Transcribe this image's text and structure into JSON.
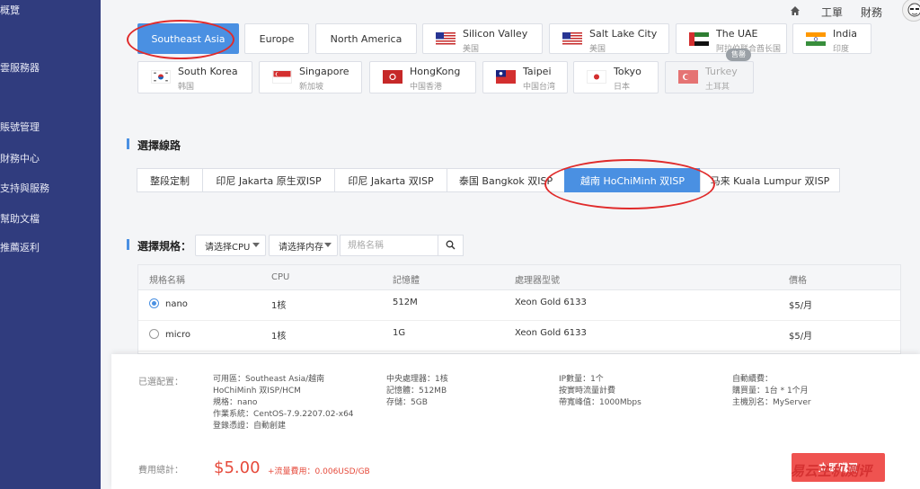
{
  "sidebar": {
    "items": [
      "概覽",
      "雲服務器",
      "賬號管理",
      "財務中心",
      "支持與服務",
      "幫助文檔",
      "推薦返利"
    ]
  },
  "topnav": {
    "workorder": "工單",
    "finance": "財務"
  },
  "regions": {
    "row1": [
      {
        "en": "Southeast Asia"
      },
      {
        "en": "Europe"
      },
      {
        "en": "North America"
      },
      {
        "en": "Silicon Valley",
        "zh": "美国",
        "flag": "us"
      },
      {
        "en": "Salt Lake City",
        "zh": "美国",
        "flag": "us"
      },
      {
        "en": "The UAE",
        "zh": "阿拉伯联合酋长国",
        "flag": "ae"
      },
      {
        "en": "India",
        "zh": "印度",
        "flag": "in"
      }
    ],
    "row2": [
      {
        "en": "South Korea",
        "zh": "韩国",
        "flag": "kr"
      },
      {
        "en": "Singapore",
        "zh": "新加坡",
        "flag": "sg"
      },
      {
        "en": "HongKong",
        "zh": "中国香港",
        "flag": "hk"
      },
      {
        "en": "Taipei",
        "zh": "中国台湾",
        "flag": "tw"
      },
      {
        "en": "Tokyo",
        "zh": "日本",
        "flag": "jp"
      },
      {
        "en": "Turkey",
        "zh": "土耳其",
        "flag": "tr"
      }
    ],
    "hot_badge": "售罄"
  },
  "line_section": {
    "title": "選擇線路",
    "tabs": [
      "整段定制",
      "印尼 Jakarta 原生双ISP",
      "印尼 Jakarta 双ISP",
      "泰国 Bangkok 双ISP",
      "越南 HoChiMinh 双ISP",
      "马来 Kuala Lumpur 双ISP"
    ]
  },
  "spec_section": {
    "title": "選擇規格：",
    "cpu_select": "请选择CPU",
    "mem_select": "请选择内存",
    "search_placeholder": "規格名稱"
  },
  "table": {
    "headers": [
      "規格名稱",
      "CPU",
      "記憶體",
      "處理器型號",
      "價格"
    ],
    "rows": [
      {
        "name": "nano",
        "cpu": "1核",
        "mem": "512M",
        "proc": "Xeon Gold 6133",
        "price": "$5/月"
      },
      {
        "name": "micro",
        "cpu": "1核",
        "mem": "1G",
        "proc": "Xeon Gold 6133",
        "price": "$5/月"
      }
    ]
  },
  "summary": {
    "config_label": "已選配置：",
    "col1": [
      "可用區：Southeast Asia/越南",
      "HoChiMinh 双ISP/HCM",
      "規格：nano",
      "作業系統：CentOS-7.9.2207.02-x64",
      "登錄憑證：自動創建"
    ],
    "col2": [
      "中央處理器：1核",
      "記憶體：512MB",
      "存儲：5GB"
    ],
    "col3": [
      "IP數量：1个",
      "按實時流量計費",
      "帶寬峰值：1000Mbps"
    ],
    "col4": [
      "自動續費：",
      "購買量：1台 * 1个月",
      "主機別名：MyServer"
    ],
    "total_label": "費用總計：",
    "price": "$5.00",
    "price_extra": "+流量費用：0.006USD/GB",
    "buy_button": "立即購買",
    "watermark": "易云主机测评"
  },
  "colors": {
    "accent": "#4a90e2",
    "sidebar": "#303c7e",
    "danger": "#e64a3b",
    "annotation": "#e02b2b"
  }
}
